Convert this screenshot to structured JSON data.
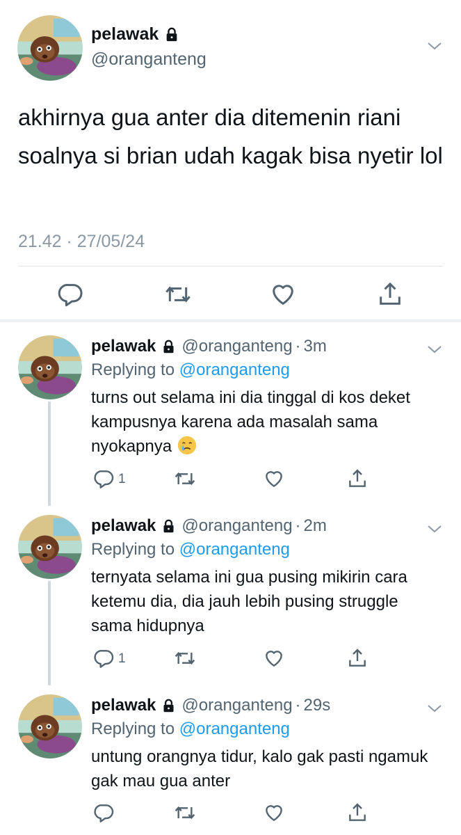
{
  "main_tweet": {
    "display_name": "pelawak",
    "handle": "@oranganteng",
    "text": "akhirnya gua anter dia ditemenin riani soalnya si brian udah kagak bisa nyetir lol",
    "timestamp": "21.42 · 27/05/24",
    "icons": {
      "lock": "lock-icon",
      "menu": "chevron-down-icon",
      "reply": "reply-icon",
      "retweet": "retweet-icon",
      "like": "like-icon",
      "share": "share-icon"
    }
  },
  "replies": [
    {
      "display_name": "pelawak",
      "handle": "@oranganteng",
      "dot": "·",
      "time": "3m",
      "replying_prefix": "Replying to",
      "replying_to": "@oranganteng",
      "text": "turns out selama ini dia tinggal di kos deket kampusnya karena ada masalah sama nyokapnya",
      "emoji": "crying-face-emoji",
      "reply_count": "1"
    },
    {
      "display_name": "pelawak",
      "handle": "@oranganteng",
      "dot": "·",
      "time": "2m",
      "replying_prefix": "Replying to",
      "replying_to": "@oranganteng",
      "text": "ternyata selama ini gua pusing mikirin cara ketemu dia, dia jauh lebih pusing struggle sama hidupnya",
      "reply_count": "1"
    },
    {
      "display_name": "pelawak",
      "handle": "@oranganteng",
      "dot": "·",
      "time": "29s",
      "replying_prefix": "Replying to",
      "replying_to": "@oranganteng",
      "text": "untung orangnya tidur, kalo gak pasti ngamuk gak mau gua anter",
      "reply_count": ""
    }
  ],
  "colors": {
    "text": "#0f1419",
    "secondary": "#536471",
    "link": "#1d9bf0",
    "divider": "#dfe3e6",
    "thread_line": "#cfd9de"
  }
}
